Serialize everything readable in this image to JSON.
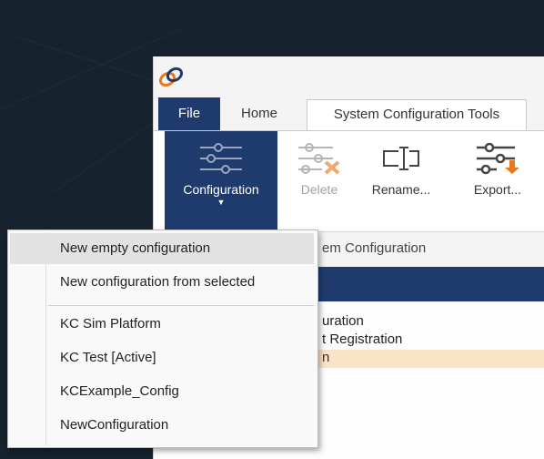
{
  "tabs": {
    "file": "File",
    "home": "Home",
    "system_config_tools": "System Configuration Tools"
  },
  "ribbon": {
    "configuration": "Configuration",
    "delete": "Delete",
    "rename": "Rename...",
    "export": "Export..."
  },
  "section": {
    "title_partial": "em Configuration"
  },
  "list": {
    "row1": "uration",
    "row2": "t Registration",
    "row3": "n"
  },
  "menu": {
    "items": [
      "New empty configuration",
      "New configuration from selected",
      "KC Sim Platform",
      "KC Test [Active]",
      "KCExample_Config",
      "NewConfiguration"
    ]
  },
  "colors": {
    "accent": "#1f3b6e",
    "orange": "#e8771d",
    "highlight_row": "#fbe3c8"
  }
}
